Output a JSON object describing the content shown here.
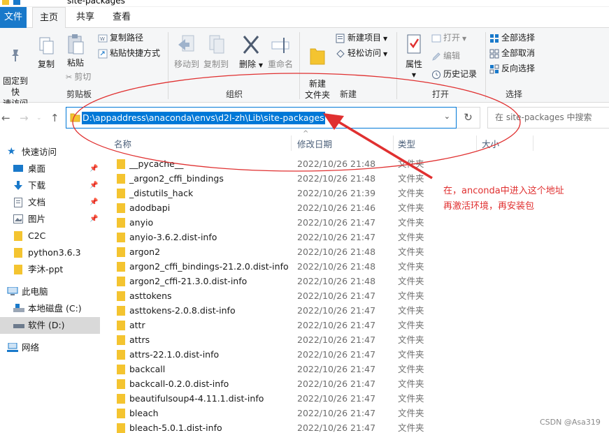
{
  "window": {
    "title": "site-packages"
  },
  "tabs": [
    {
      "label": "文件"
    },
    {
      "label": "主页"
    },
    {
      "label": "共享"
    },
    {
      "label": "查看"
    }
  ],
  "ribbon": {
    "clipboard": {
      "pin_quick_access": "固定到快\n速访问",
      "copy": "复制",
      "paste": "粘贴",
      "cut": "剪切",
      "copy_path": "复制路径",
      "paste_shortcut": "粘贴快捷方式",
      "group_label": "剪贴板"
    },
    "organize": {
      "move_to": "移动到",
      "copy_to": "复制到",
      "delete": "删除",
      "rename": "重命名",
      "group_label": "组织"
    },
    "new": {
      "new_folder": "新建\n文件夹",
      "new_item": "新建项目",
      "easy_access": "轻松访问",
      "group_label": "新建"
    },
    "open": {
      "properties": "属性",
      "open": "打开",
      "edit": "编辑",
      "history": "历史记录",
      "group_label": "打开"
    },
    "select": {
      "select_all": "全部选择",
      "select_none": "全部取消",
      "invert": "反向选择",
      "group_label": "选择"
    }
  },
  "address": {
    "path": "D:\\appaddress\\anaconda\\envs\\d2l-zh\\Lib\\site-packages",
    "search_placeholder": "在 site-packages 中搜索"
  },
  "nav_pane": {
    "items": [
      {
        "label": "快速访问",
        "icon": "star-icon",
        "pinned": false
      },
      {
        "label": "桌面",
        "icon": "desktop-icon",
        "pinned": true
      },
      {
        "label": "下载",
        "icon": "download-icon",
        "pinned": true
      },
      {
        "label": "文档",
        "icon": "document-icon",
        "pinned": true
      },
      {
        "label": "图片",
        "icon": "picture-icon",
        "pinned": true
      },
      {
        "label": "C2C",
        "icon": "folder-icon",
        "pinned": false
      },
      {
        "label": "python3.6.3",
        "icon": "folder-icon",
        "pinned": false
      },
      {
        "label": "李沐-ppt",
        "icon": "folder-icon",
        "pinned": false
      },
      {
        "label": "此电脑",
        "icon": "computer-icon",
        "pinned": false
      },
      {
        "label": "本地磁盘 (C:)",
        "icon": "drive-icon",
        "pinned": false
      },
      {
        "label": "软件 (D:)",
        "icon": "drive-icon",
        "pinned": false
      },
      {
        "label": "网络",
        "icon": "network-icon",
        "pinned": false
      }
    ]
  },
  "file_list": {
    "columns": [
      "名称",
      "修改日期",
      "类型",
      "大小"
    ],
    "rows": [
      {
        "name": "__pycache__",
        "date": "2022/10/26 21:48",
        "type": "文件夹"
      },
      {
        "name": "_argon2_cffi_bindings",
        "date": "2022/10/26 21:48",
        "type": "文件夹"
      },
      {
        "name": "_distutils_hack",
        "date": "2022/10/26 21:39",
        "type": "文件夹"
      },
      {
        "name": "adodbapi",
        "date": "2022/10/26 21:46",
        "type": "文件夹"
      },
      {
        "name": "anyio",
        "date": "2022/10/26 21:47",
        "type": "文件夹"
      },
      {
        "name": "anyio-3.6.2.dist-info",
        "date": "2022/10/26 21:47",
        "type": "文件夹"
      },
      {
        "name": "argon2",
        "date": "2022/10/26 21:48",
        "type": "文件夹"
      },
      {
        "name": "argon2_cffi_bindings-21.2.0.dist-info",
        "date": "2022/10/26 21:48",
        "type": "文件夹"
      },
      {
        "name": "argon2_cffi-21.3.0.dist-info",
        "date": "2022/10/26 21:48",
        "type": "文件夹"
      },
      {
        "name": "asttokens",
        "date": "2022/10/26 21:47",
        "type": "文件夹"
      },
      {
        "name": "asttokens-2.0.8.dist-info",
        "date": "2022/10/26 21:47",
        "type": "文件夹"
      },
      {
        "name": "attr",
        "date": "2022/10/26 21:47",
        "type": "文件夹"
      },
      {
        "name": "attrs",
        "date": "2022/10/26 21:47",
        "type": "文件夹"
      },
      {
        "name": "attrs-22.1.0.dist-info",
        "date": "2022/10/26 21:47",
        "type": "文件夹"
      },
      {
        "name": "backcall",
        "date": "2022/10/26 21:47",
        "type": "文件夹"
      },
      {
        "name": "backcall-0.2.0.dist-info",
        "date": "2022/10/26 21:47",
        "type": "文件夹"
      },
      {
        "name": "beautifulsoup4-4.11.1.dist-info",
        "date": "2022/10/26 21:47",
        "type": "文件夹"
      },
      {
        "name": "bleach",
        "date": "2022/10/26 21:47",
        "type": "文件夹"
      },
      {
        "name": "bleach-5.0.1.dist-info",
        "date": "2022/10/26 21:47",
        "type": "文件夹"
      }
    ]
  },
  "annotation": {
    "line1": "在，anconda中进入这个地址",
    "line2": "再激活环境，再安装包",
    "color": "#e03030"
  },
  "watermark": "CSDN @Asa319",
  "colors": {
    "accent": "#0078d7",
    "folder": "#f4c430",
    "file_tab": "#1979ca"
  }
}
